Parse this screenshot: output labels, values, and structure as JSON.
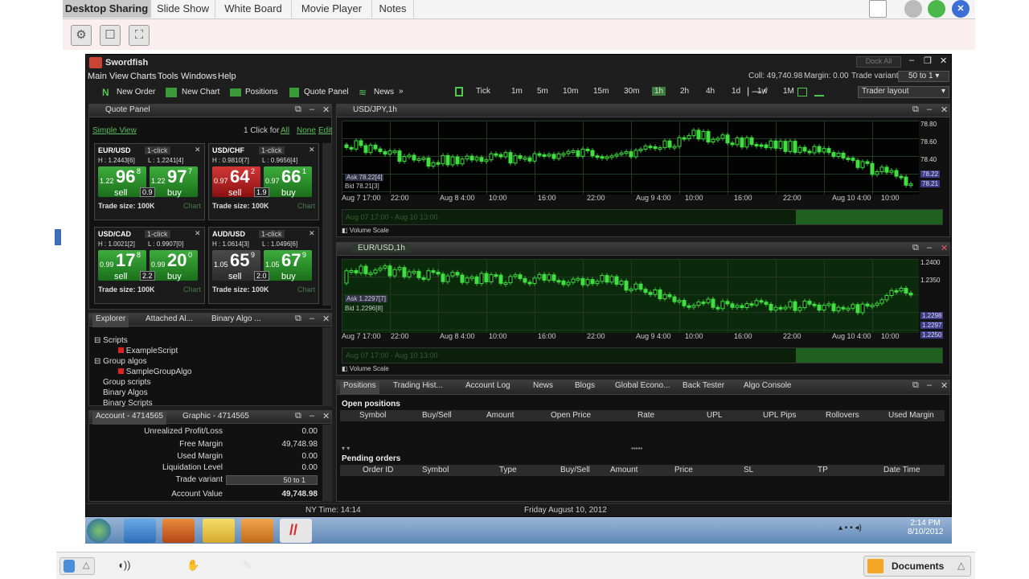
{
  "top_tabs": [
    "Desktop Sharing",
    "Slide Show",
    "White Board",
    "Movie Player",
    "Notes"
  ],
  "app": {
    "title": "Swordfish",
    "menu": [
      "Main",
      "View",
      "Charts",
      "Tools",
      "Windows",
      "Help"
    ],
    "dock_all": "Dock All",
    "toolbar": {
      "new_order": "New Order",
      "new_chart": "New Chart",
      "positions": "Positions",
      "quote_panel": "Quote Panel",
      "news": "News",
      "more": "»"
    },
    "timeframes": [
      "Tick",
      "1m",
      "5m",
      "10m",
      "15m",
      "30m",
      "1h",
      "2h",
      "4h",
      "1d",
      "1w",
      "1M"
    ],
    "active_tf": "1h",
    "status": {
      "coll": "Coll: 49,740.98",
      "margin": "Margin: 0.00",
      "trade_variant_label": "Trade variant:",
      "trade_variant": "50 to 1",
      "layout": "Trader layout"
    }
  },
  "quote_panel": {
    "title": "Quote Panel",
    "simple_view": "Simple View",
    "one_click": "1 Click for",
    "all": "All",
    "none": "None",
    "edit": "Edit",
    "tiles": [
      {
        "pair": "EUR/USD",
        "mode": "1-click",
        "h": "H : 1.2443[6]",
        "l": "L : 1.2241[4]",
        "sell_pre": "1.22",
        "sell_big": "96",
        "sell_sup": "8",
        "buy_pre": "1.22",
        "buy_big": "97",
        "buy_sup": "7",
        "spread": "0.9",
        "sell": "sell",
        "buy": "buy",
        "size": "Trade size: 100K",
        "chart": "Chart",
        "sell_color": "g"
      },
      {
        "pair": "USD/CHF",
        "mode": "1-click",
        "h": "H : 0.9810[7]",
        "l": "L : 0.9656[4]",
        "sell_pre": "0.97",
        "sell_big": "64",
        "sell_sup": "2",
        "buy_pre": "0.97",
        "buy_big": "66",
        "buy_sup": "1",
        "spread": "1.9",
        "sell": "sell",
        "buy": "buy",
        "size": "Trade size: 100K",
        "chart": "Chart",
        "sell_color": "r"
      },
      {
        "pair": "USD/CAD",
        "mode": "1-click",
        "h": "H : 1.0021[2]",
        "l": "L : 0.9907[0]",
        "sell_pre": "0.99",
        "sell_big": "17",
        "sell_sup": "8",
        "buy_pre": "0.99",
        "buy_big": "20",
        "buy_sup": "0",
        "spread": "2.2",
        "sell": "sell",
        "buy": "buy",
        "size": "Trade size: 100K",
        "chart": "Chart",
        "sell_color": "g"
      },
      {
        "pair": "AUD/USD",
        "mode": "1-click",
        "h": "H : 1.0614[3]",
        "l": "L : 1.0496[6]",
        "sell_pre": "1.05",
        "sell_big": "65",
        "sell_sup": "9",
        "buy_pre": "1.05",
        "buy_big": "67",
        "buy_sup": "9",
        "spread": "2.0",
        "sell": "sell",
        "buy": "buy",
        "size": "Trade size: 100K",
        "chart": "Chart",
        "sell_color": "gr"
      }
    ]
  },
  "explorer": {
    "tabs": [
      "Explorer",
      "Attached Al...",
      "Binary Algo ..."
    ],
    "items": [
      "Scripts",
      "ExampleScript",
      "Group algos",
      "SampleGroupAlgo",
      "Group scripts",
      "Binary Algos",
      "Binary Scripts"
    ]
  },
  "account": {
    "tabs": [
      "Account - 4714565",
      "Graphic - 4714565"
    ],
    "rows": [
      {
        "label": "Unrealized Profit/Loss",
        "value": "0.00"
      },
      {
        "label": "Free Margin",
        "value": "49,748.98"
      },
      {
        "label": "Used Margin",
        "value": "0.00"
      },
      {
        "label": "Liquidation Level",
        "value": "0.00"
      },
      {
        "label": "Trade variant",
        "value": "50 to 1"
      },
      {
        "label": "Account Value",
        "value": "49,748.98"
      }
    ]
  },
  "chart1": {
    "title": "USD/JPY,1h",
    "ask": "Ask 78.22[4]",
    "bid": "Bid 78.21[3]",
    "ylabels": [
      "78.80",
      "78.60",
      "78.40",
      "78.22",
      "78.21"
    ],
    "xlabels": [
      "Aug 7 17:00",
      "22:00",
      "Aug 8 4:00",
      "10:00",
      "16:00",
      "22:00",
      "Aug 9 4:00",
      "10:00",
      "16:00",
      "22:00",
      "Aug 10 4:00",
      "10:00"
    ],
    "navigator": "Aug 07 17:00 - Aug 10 13:00",
    "volume": "Volume Scale"
  },
  "chart2": {
    "title": "EUR/USD,1h",
    "ask": "Ask 1.2297[7]",
    "bid": "Bid 1.2296[8]",
    "ylabels": [
      "1.2400",
      "1.2350",
      "1.2298",
      "1.2297",
      "1.2250"
    ],
    "xlabels": [
      "Aug 7 17:00",
      "22:00",
      "Aug 8 4:00",
      "10:00",
      "16:00",
      "22:00",
      "Aug 9 4:00",
      "10:00",
      "16:00",
      "22:00",
      "Aug 10 4:00",
      "10:00"
    ],
    "navigator": "Aug 07 17:00 - Aug 10 13:00",
    "volume": "Volume Scale"
  },
  "positions": {
    "tabs": [
      "Positions",
      "Trading Hist...",
      "Account Log",
      "News",
      "Blogs",
      "Global Econo...",
      "Back Tester",
      "Algo Console"
    ],
    "open_title": "Open positions",
    "open_cols": [
      "Symbol",
      "Buy/Sell",
      "Amount",
      "Open Price",
      "Rate",
      "UPL",
      "UPL Pips",
      "Rollovers",
      "Used Margin"
    ],
    "pending_title": "Pending orders",
    "pending_cols": [
      "Order ID",
      "Symbol",
      "Type",
      "Buy/Sell",
      "Amount",
      "Price",
      "SL",
      "TP",
      "Date Time"
    ]
  },
  "statusbar": {
    "ny_time": "NY Time: 14:14",
    "date": "Friday August 10, 2012"
  },
  "taskbar": {
    "time": "2:14 PM",
    "date": "8/10/2012"
  },
  "bottom": {
    "documents": "Documents"
  }
}
